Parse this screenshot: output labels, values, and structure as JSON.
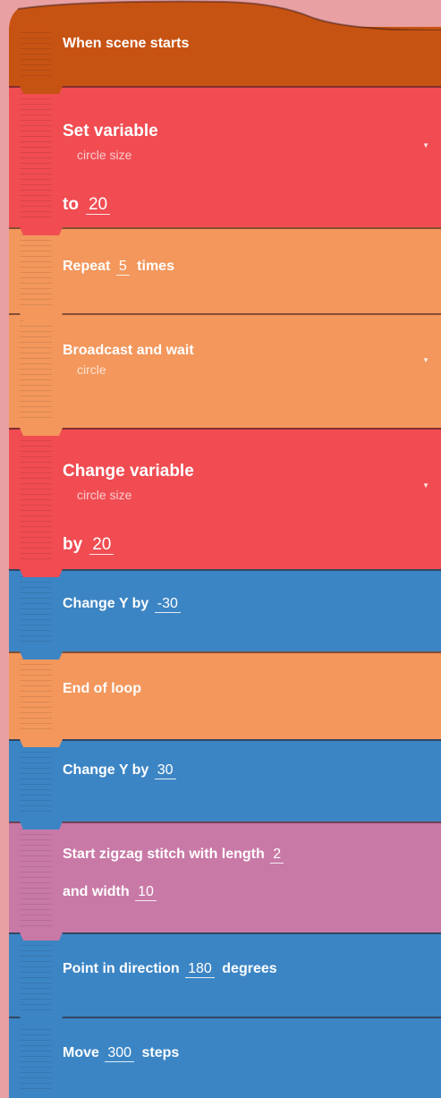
{
  "bricks": {
    "when_scene_starts": {
      "title": "When scene starts"
    },
    "set_variable": {
      "title": "Set variable",
      "variable": "circle size",
      "to_label": "to",
      "value": "20"
    },
    "repeat": {
      "prefix": "Repeat",
      "value": "5",
      "suffix": "times"
    },
    "broadcast_wait": {
      "title": "Broadcast and wait",
      "message": "circle"
    },
    "change_variable": {
      "title": "Change variable",
      "variable": "circle size",
      "by_label": "by",
      "value": "20"
    },
    "change_y_1": {
      "prefix": "Change Y by",
      "value": "-30"
    },
    "end_loop": {
      "title": "End of loop"
    },
    "change_y_2": {
      "prefix": "Change Y by",
      "value": "30"
    },
    "zigzag": {
      "prefix": "Start zigzag stitch with length",
      "length": "2",
      "width_label": "and width",
      "width": "10"
    },
    "point_direction": {
      "prefix": "Point in direction",
      "value": "180",
      "suffix": "degrees"
    },
    "move": {
      "prefix": "Move",
      "value": "300",
      "suffix": "steps"
    }
  },
  "colors": {
    "event": "#c75313",
    "data": "#f04c52",
    "control": "#f3975c",
    "motion": "#3c85c4",
    "embroidery": "#c979a6",
    "background": "#e9a0a3"
  },
  "icons": {
    "dropdown": "dropdown-arrow-icon",
    "grip": "drag-handle-icon"
  }
}
